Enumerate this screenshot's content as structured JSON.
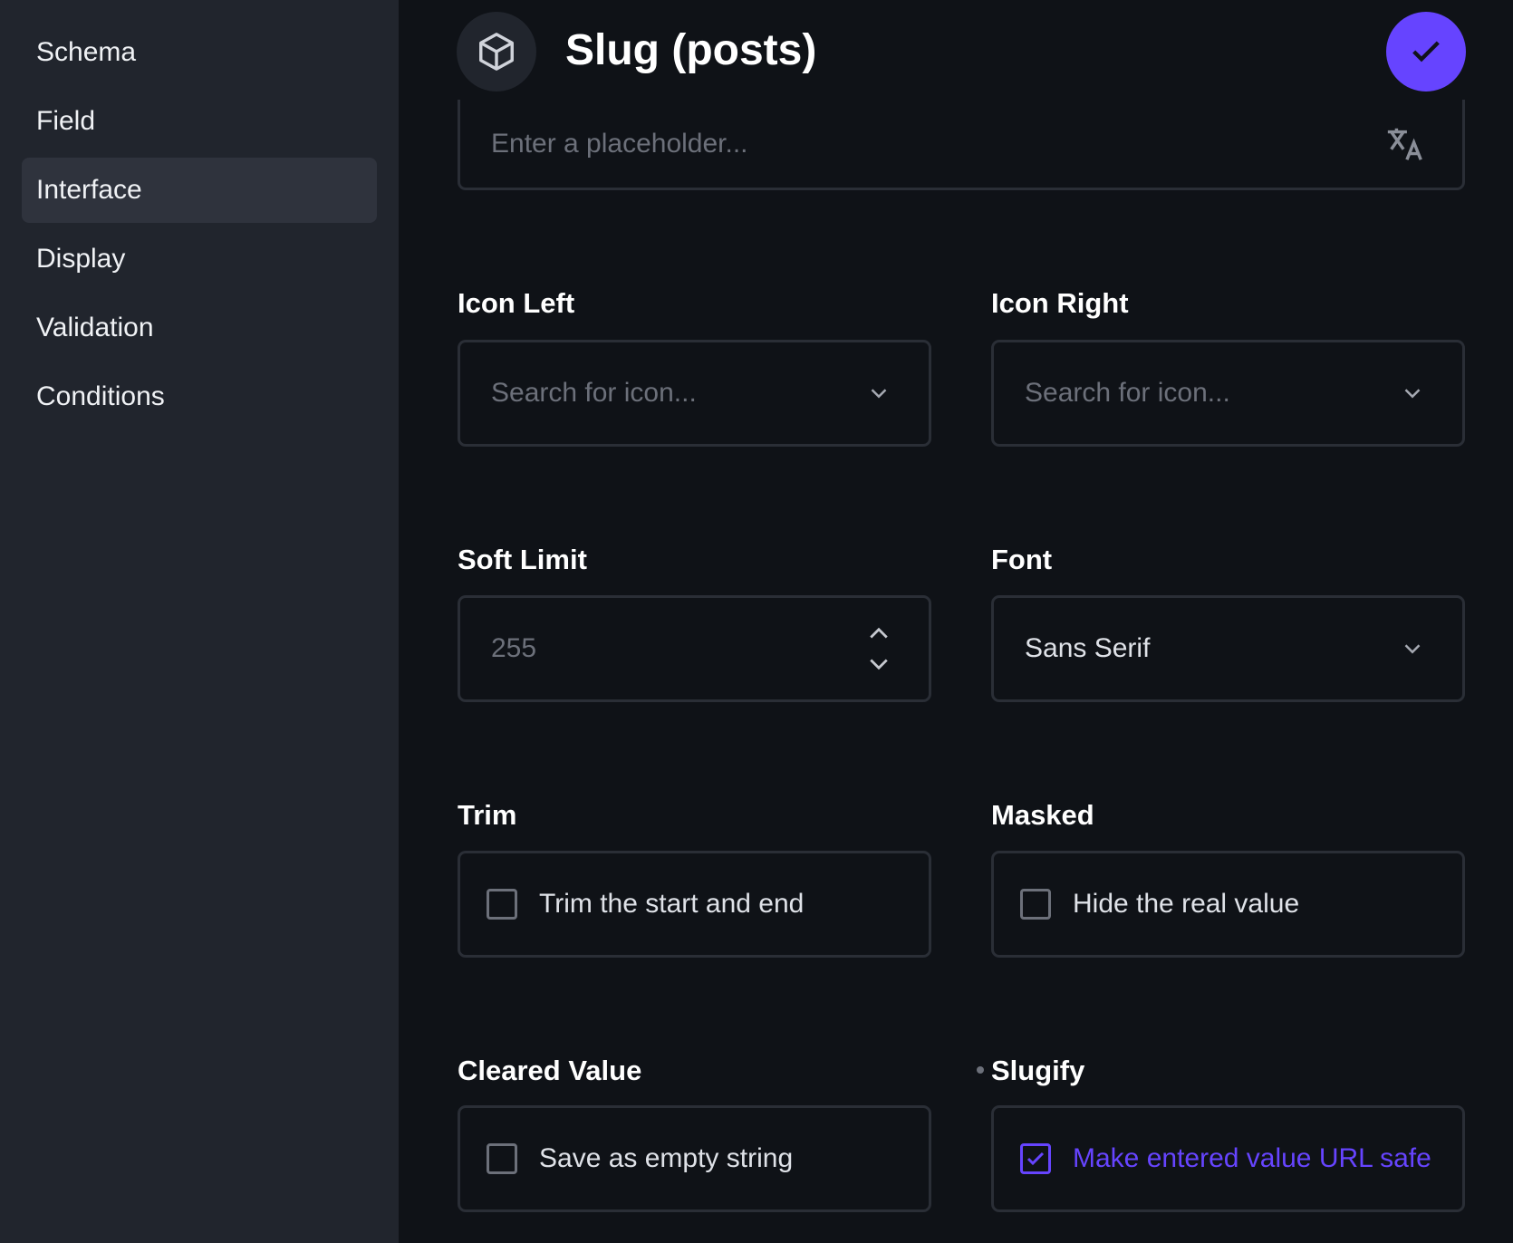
{
  "sidebar": {
    "items": [
      {
        "label": "Schema"
      },
      {
        "label": "Field"
      },
      {
        "label": "Interface",
        "active": true
      },
      {
        "label": "Display"
      },
      {
        "label": "Validation"
      },
      {
        "label": "Conditions"
      }
    ]
  },
  "header": {
    "title": "Slug (posts)",
    "icon": "cube-icon",
    "save_icon": "check-icon"
  },
  "colors": {
    "accent": "#6644ff",
    "sidebar_bg": "#21252d",
    "main_bg": "#0f1217"
  },
  "placeholder_field": {
    "placeholder": "Enter a placeholder...",
    "icon": "translate-icon"
  },
  "fields": {
    "icon_left": {
      "label": "Icon Left",
      "placeholder": "Search for icon..."
    },
    "icon_right": {
      "label": "Icon Right",
      "placeholder": "Search for icon..."
    },
    "soft_limit": {
      "label": "Soft Limit",
      "placeholder": "255"
    },
    "font": {
      "label": "Font",
      "value": "Sans Serif"
    },
    "trim": {
      "label": "Trim",
      "option": "Trim the start and end",
      "checked": false
    },
    "masked": {
      "label": "Masked",
      "option": "Hide the real value",
      "checked": false
    },
    "cleared_value": {
      "label": "Cleared Value",
      "option": "Save as empty string",
      "checked": false
    },
    "slugify": {
      "label": "Slugify",
      "option": "Make entered value URL safe",
      "checked": true
    }
  }
}
